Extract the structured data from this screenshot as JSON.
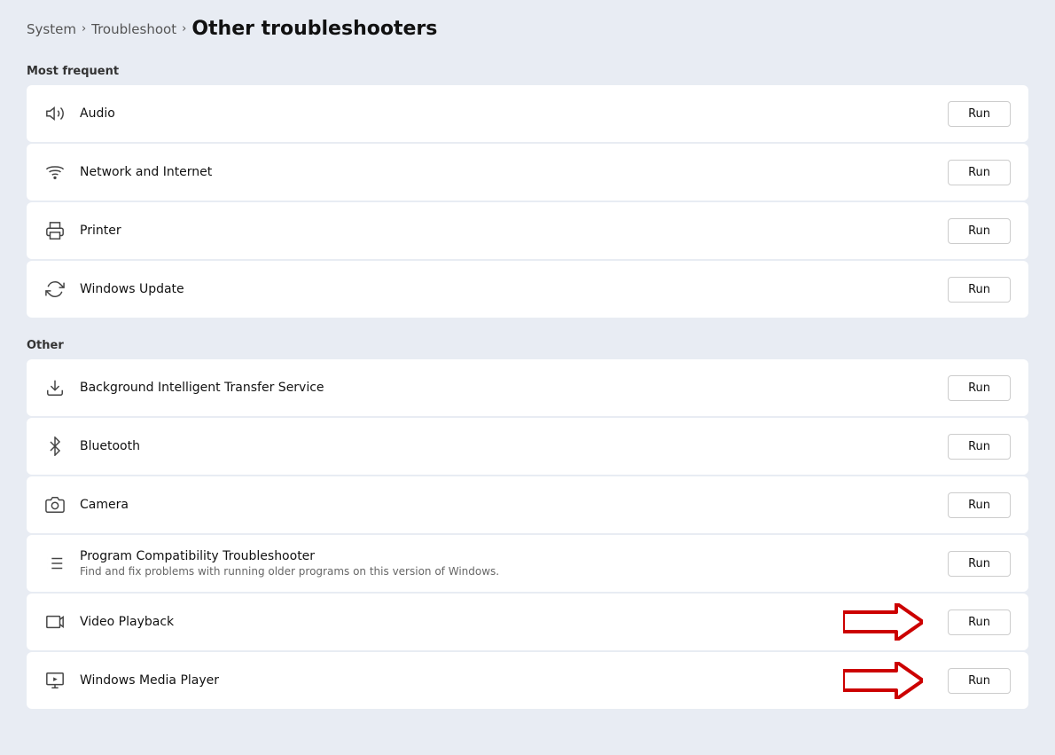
{
  "breadcrumb": {
    "items": [
      {
        "label": "System",
        "id": "system"
      },
      {
        "label": "Troubleshoot",
        "id": "troubleshoot"
      }
    ],
    "current": "Other troubleshooters"
  },
  "sections": [
    {
      "id": "most-frequent",
      "label": "Most frequent",
      "items": [
        {
          "id": "audio",
          "title": "Audio",
          "subtitle": "",
          "icon": "audio-icon",
          "button": "Run",
          "hasArrow": false
        },
        {
          "id": "network-internet",
          "title": "Network and Internet",
          "subtitle": "",
          "icon": "network-icon",
          "button": "Run",
          "hasArrow": false
        },
        {
          "id": "printer",
          "title": "Printer",
          "subtitle": "",
          "icon": "printer-icon",
          "button": "Run",
          "hasArrow": false
        },
        {
          "id": "windows-update",
          "title": "Windows Update",
          "subtitle": "",
          "icon": "update-icon",
          "button": "Run",
          "hasArrow": false
        }
      ]
    },
    {
      "id": "other",
      "label": "Other",
      "items": [
        {
          "id": "bits",
          "title": "Background Intelligent Transfer Service",
          "subtitle": "",
          "icon": "download-icon",
          "button": "Run",
          "hasArrow": false
        },
        {
          "id": "bluetooth",
          "title": "Bluetooth",
          "subtitle": "",
          "icon": "bluetooth-icon",
          "button": "Run",
          "hasArrow": false
        },
        {
          "id": "camera",
          "title": "Camera",
          "subtitle": "",
          "icon": "camera-icon",
          "button": "Run",
          "hasArrow": false
        },
        {
          "id": "program-compat",
          "title": "Program Compatibility Troubleshooter",
          "subtitle": "Find and fix problems with running older programs on this version of Windows.",
          "icon": "compat-icon",
          "button": "Run",
          "hasArrow": false
        },
        {
          "id": "video-playback",
          "title": "Video Playback",
          "subtitle": "",
          "icon": "video-icon",
          "button": "Run",
          "hasArrow": true
        },
        {
          "id": "windows-media-player",
          "title": "Windows Media Player",
          "subtitle": "",
          "icon": "media-player-icon",
          "button": "Run",
          "hasArrow": true
        }
      ]
    }
  ]
}
